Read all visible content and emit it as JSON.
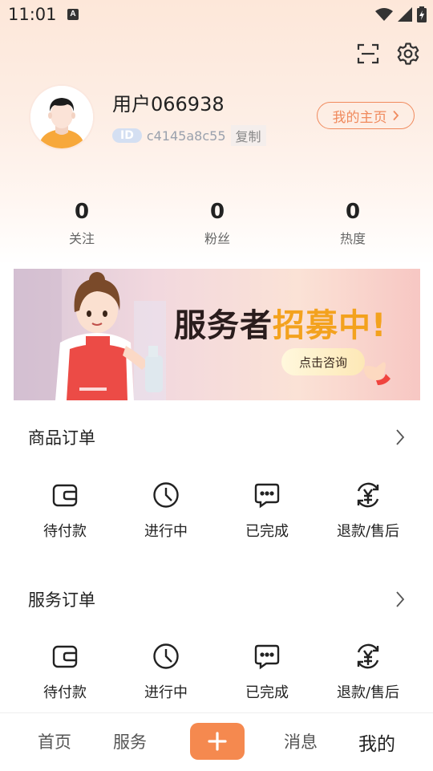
{
  "status_bar": {
    "time": "11:01",
    "notification_badge": "A"
  },
  "header": {
    "scan_icon": "scan-icon",
    "settings_icon": "gear-icon"
  },
  "profile": {
    "username": "用户066938",
    "id_label": "ID",
    "id_value": "c4145a8c55",
    "copy_label": "复制",
    "homepage_label": "我的主页"
  },
  "stats": [
    {
      "value": "0",
      "label": "关注"
    },
    {
      "value": "0",
      "label": "粉丝"
    },
    {
      "value": "0",
      "label": "热度"
    }
  ],
  "banner": {
    "title_part1": "服务者",
    "title_part2": "招募中!",
    "button_label": "点击咨询"
  },
  "product_orders": {
    "title": "商品订单",
    "items": [
      {
        "label": "待付款",
        "icon": "wallet-icon"
      },
      {
        "label": "进行中",
        "icon": "clock-icon"
      },
      {
        "label": "已完成",
        "icon": "chat-icon"
      },
      {
        "label": "退款/售后",
        "icon": "refund-icon"
      }
    ]
  },
  "service_orders": {
    "title": "服务订单",
    "items": [
      {
        "label": "待付款",
        "icon": "wallet-icon"
      },
      {
        "label": "进行中",
        "icon": "clock-icon"
      },
      {
        "label": "已完成",
        "icon": "chat-icon"
      },
      {
        "label": "退款/售后",
        "icon": "refund-icon"
      }
    ]
  },
  "tabbar": {
    "tabs": [
      {
        "label": "首页"
      },
      {
        "label": "服务"
      },
      {
        "label": "消息"
      },
      {
        "label": "我的"
      }
    ],
    "accent": "#f5894f"
  },
  "colors": {
    "accent": "#f08a5d",
    "text": "#222222"
  }
}
